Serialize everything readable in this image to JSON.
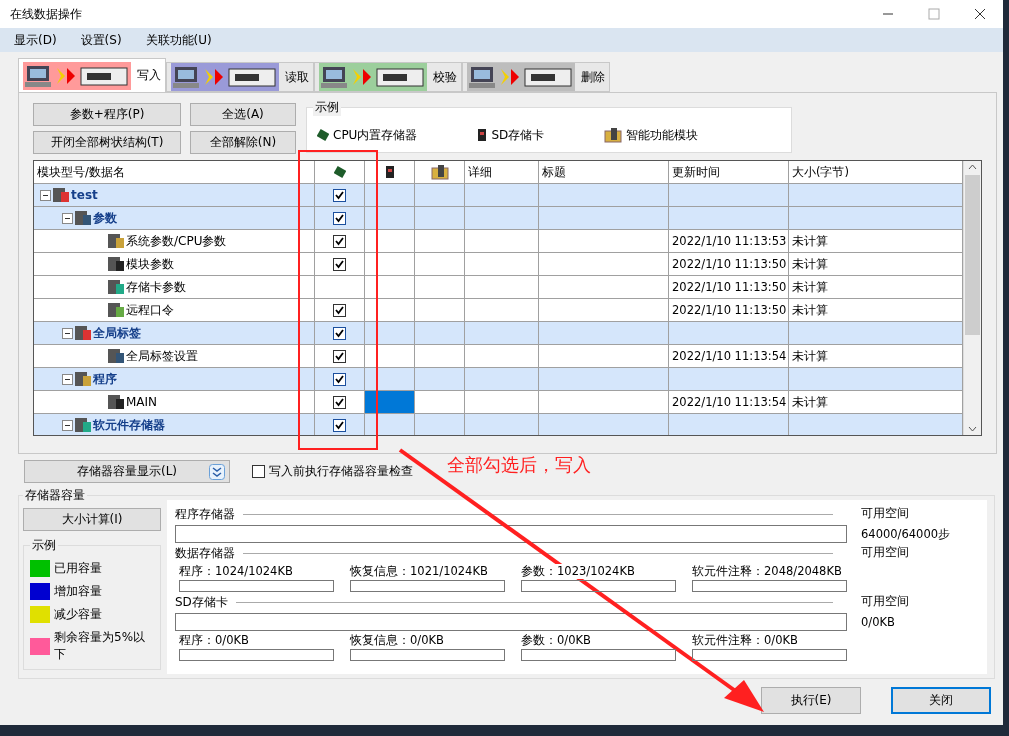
{
  "window": {
    "title": "在线数据操作"
  },
  "menu": [
    "显示(D)",
    "设置(S)",
    "关联功能(U)"
  ],
  "tabs": [
    {
      "label": "写入",
      "selected": true,
      "color": "#ff9a9a"
    },
    {
      "label": "读取",
      "selected": false,
      "color": "#9a9ad8"
    },
    {
      "label": "校验",
      "selected": false,
      "color": "#9ccf9c"
    },
    {
      "label": "删除",
      "selected": false,
      "color": "#bdbdbd"
    }
  ],
  "buttons": [
    "参数+程序(P)",
    "全选(A)",
    "开闭全部树状结构(T)",
    "全部解除(N)"
  ],
  "legend_box": {
    "title": "示例",
    "items": [
      {
        "kind": "cpu",
        "label": "CPU内置存储器"
      },
      {
        "kind": "sd",
        "label": "SD存储卡"
      },
      {
        "kind": "module",
        "label": "智能功能模块"
      }
    ]
  },
  "table": {
    "columns": [
      {
        "kind": "text",
        "label": "模块型号/数据名"
      },
      {
        "kind": "cpu"
      },
      {
        "kind": "sd"
      },
      {
        "kind": "module"
      },
      {
        "kind": "text",
        "label": "详细"
      },
      {
        "kind": "text",
        "label": "标题"
      },
      {
        "kind": "text",
        "label": "更新时间"
      },
      {
        "kind": "text",
        "label": "大小(字节)"
      }
    ],
    "rows": [
      {
        "kind": "group",
        "label": "test",
        "checked": true,
        "sd_selected": false,
        "expanded": true,
        "children": [
          {
            "kind": "group",
            "label": "参数",
            "checked": true,
            "sd_selected": false,
            "expanded": true,
            "children": [
              {
                "kind": "item",
                "label": "系统参数/CPU参数",
                "checked": true,
                "sd_selected": false,
                "time": "2022/1/10 11:13:53",
                "size": "未计算"
              },
              {
                "kind": "item",
                "label": "模块参数",
                "checked": true,
                "sd_selected": false,
                "time": "2022/1/10 11:13:50",
                "size": "未计算"
              },
              {
                "kind": "item",
                "label": "存储卡参数",
                "checked": false,
                "sd_selected": false,
                "time": "2022/1/10 11:13:50",
                "size": "未计算"
              },
              {
                "kind": "item",
                "label": "远程口令",
                "checked": true,
                "sd_selected": false,
                "time": "2022/1/10 11:13:50",
                "size": "未计算"
              }
            ]
          },
          {
            "kind": "group",
            "label": "全局标签",
            "checked": true,
            "sd_selected": false,
            "expanded": true,
            "children": [
              {
                "kind": "item",
                "label": "全局标签设置",
                "checked": true,
                "sd_selected": false,
                "time": "2022/1/10 11:13:54",
                "size": "未计算"
              }
            ]
          },
          {
            "kind": "group",
            "label": "程序",
            "checked": true,
            "sd_selected": false,
            "expanded": true,
            "children": [
              {
                "kind": "item",
                "label": "MAIN",
                "checked": true,
                "sd_selected": true,
                "time": "2022/1/10 11:13:54",
                "size": "未计算"
              }
            ]
          },
          {
            "kind": "group",
            "label": "软元件存储器",
            "checked": true,
            "sd_selected": false,
            "expanded": true
          }
        ]
      }
    ]
  },
  "capacity_button": "存储器容量显示(L)",
  "precheck": {
    "label": "写入前执行存储器容量检查",
    "checked": false
  },
  "capacity": {
    "title": "存储器容量",
    "calc_button": "大小计算(I)",
    "legend": {
      "title": "示例",
      "items": [
        {
          "label": "已用容量",
          "color": "#00c000"
        },
        {
          "label": "增加容量",
          "color": "#0000d0"
        },
        {
          "label": "减少容量",
          "color": "#e0e000"
        },
        {
          "label": "剩余容量为5%以下",
          "color": "#ff5a9a"
        }
      ]
    },
    "sections": [
      {
        "kind": "single",
        "title": "程序存储器",
        "free_label": "可用空间",
        "free": "64000/64000步"
      },
      {
        "kind": "split",
        "title": "数据存储器",
        "free_label": "可用空间",
        "parts": [
          "程序：1024/1024KB",
          "恢复信息：1021/1024KB",
          "参数：1023/1024KB",
          "软元件注释：2048/2048KB"
        ]
      },
      {
        "kind": "card",
        "title": "SD存储卡",
        "free_label": "可用空间",
        "free": "0/0KB",
        "parts": [
          "程序：0/0KB",
          "恢复信息：0/0KB",
          "参数：0/0KB",
          "软元件注释：0/0KB"
        ]
      }
    ]
  },
  "footer": [
    {
      "label": "执行(E)",
      "selected": false
    },
    {
      "label": "关闭",
      "selected": true
    }
  ],
  "annotation": "全部勾选后，写入"
}
